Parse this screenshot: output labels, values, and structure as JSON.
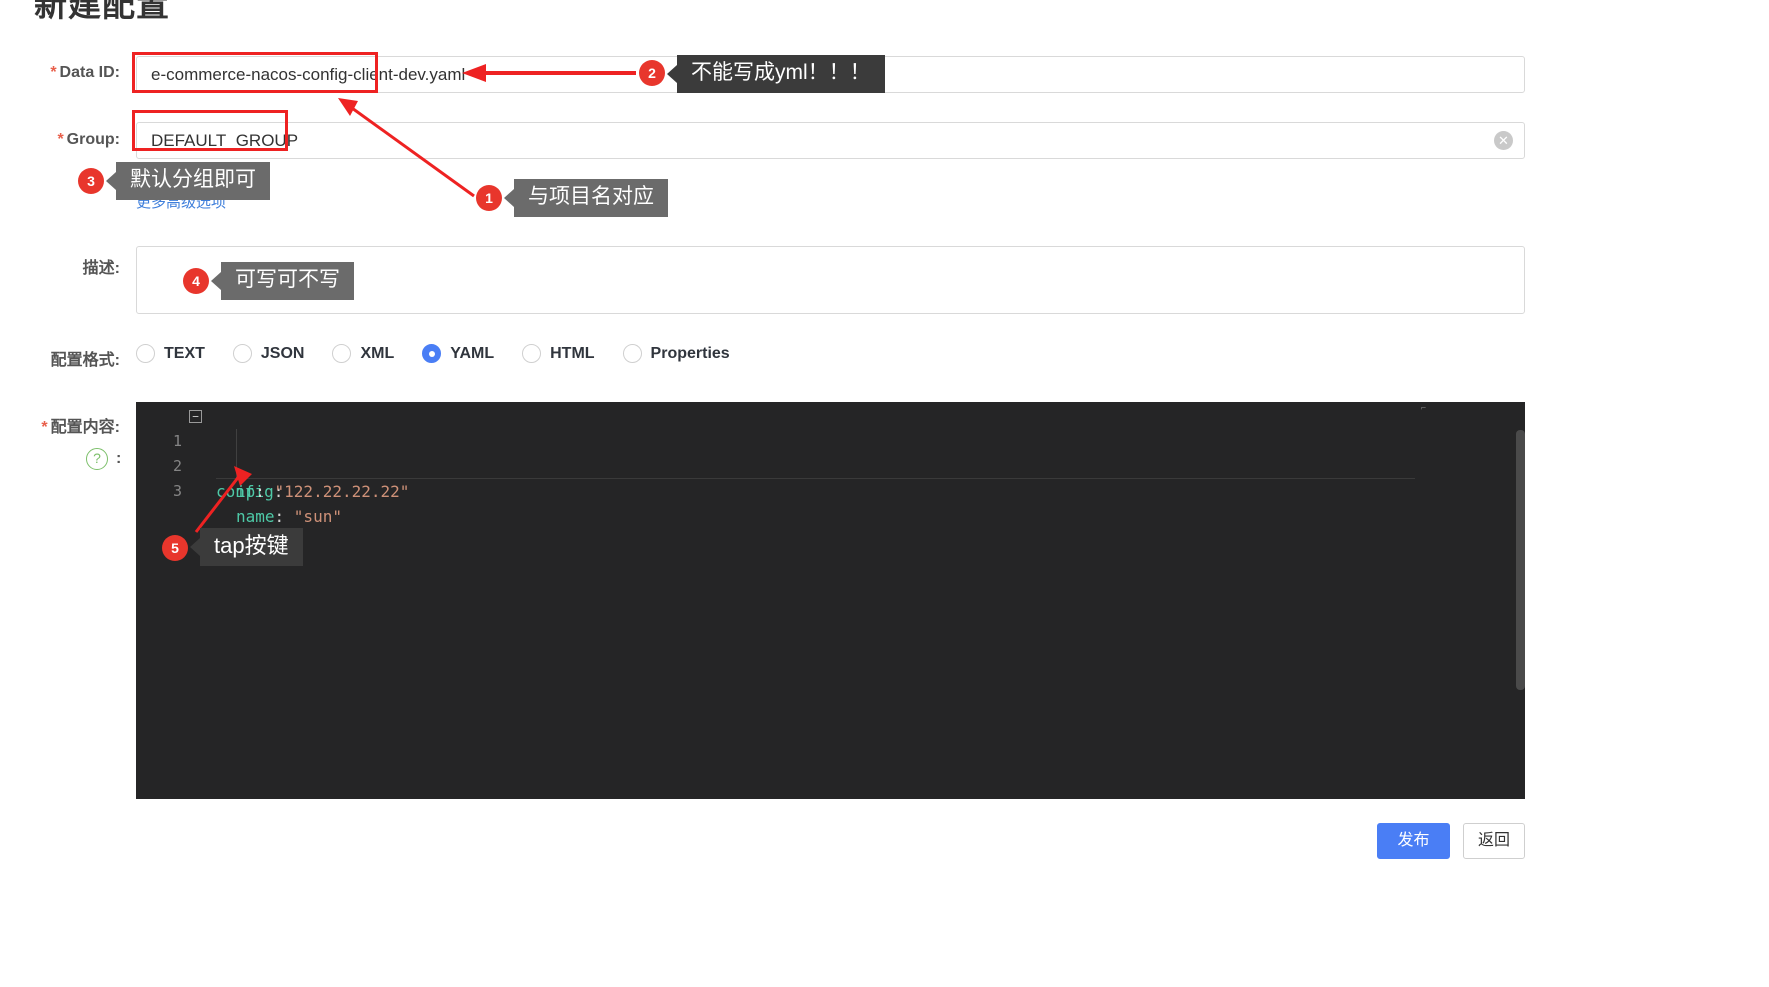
{
  "page": {
    "title": "新建配置"
  },
  "form": {
    "data_id": {
      "label": "Data ID:",
      "required": true,
      "value": "e-commerce-nacos-config-client-dev.yaml",
      "placeholder": ""
    },
    "group": {
      "label": "Group:",
      "required": true,
      "value": "DEFAULT_GROUP",
      "placeholder": "",
      "clear_icon": "clear-circle-icon"
    },
    "advanced_link": "更多高级选项",
    "description": {
      "label": "描述:",
      "required": false,
      "value": "",
      "placeholder": ""
    },
    "config_format": {
      "label": "配置格式:",
      "selected": "YAML",
      "options": [
        "TEXT",
        "JSON",
        "XML",
        "YAML",
        "HTML",
        "Properties"
      ]
    },
    "config_content": {
      "label": "配置内容:",
      "required": true,
      "help_icon": "question-circle-icon",
      "colon": ":"
    }
  },
  "editor": {
    "lines": [
      {
        "num": "1",
        "fold": "−",
        "indent": "",
        "key": "config",
        "punc": ":",
        "value": ""
      },
      {
        "num": "2",
        "fold": "",
        "indent": "    ",
        "key": "ip",
        "punc": ": ",
        "value": "\"122.22.22.22\""
      },
      {
        "num": "3",
        "fold": "",
        "indent": "    ",
        "key": "name",
        "punc": ": ",
        "value": "\"sun\""
      }
    ],
    "minimap_hint": "⌐"
  },
  "footer": {
    "publish_label": "发布",
    "back_label": "返回"
  },
  "annotations": [
    {
      "number": "1",
      "text": "与项目名对应"
    },
    {
      "number": "2",
      "text": "不能写成yml！！！"
    },
    {
      "number": "3",
      "text": "默认分组即可"
    },
    {
      "number": "4",
      "text": "可写可不写"
    },
    {
      "number": "5",
      "text": "tap按键"
    }
  ],
  "colors": {
    "accent": "#4a7ef5",
    "annotation_red": "#e8362c",
    "callout_gray": "#6b6b6b",
    "editor_bg": "#252526"
  }
}
